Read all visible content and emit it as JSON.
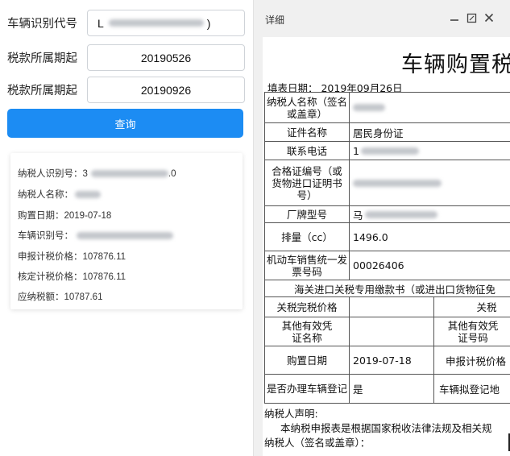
{
  "query_form": {
    "vin_label": "车辆识别代号",
    "vin_value": "L",
    "vin_value_end": ")",
    "period_start_label": "税款所属期起",
    "period_start_value": "20190526",
    "period_end_label": "税款所属期起",
    "period_end_value": "20190926",
    "query_button": "查询"
  },
  "result": {
    "taxpayer_id_label": "纳税人识别号：",
    "taxpayer_id_value": "3",
    "taxpayer_id_tail": ".0",
    "taxpayer_name_label": "纳税人名称：",
    "purchase_date_label": "购置日期：",
    "purchase_date_value": "2019-07-18",
    "vin_label": "车辆识别号：",
    "declared_price_label": "申报计税价格：",
    "declared_price_value": "107876.11",
    "assessed_price_label": "核定计税价格：",
    "assessed_price_value": "107876.11",
    "tax_payable_label": "应纳税额：",
    "tax_payable_value": "10787.61"
  },
  "dialog": {
    "title": "详细",
    "minimize_icon": "minimize-icon",
    "maximize_icon": "maximize-icon",
    "close_icon": "close-icon",
    "doc_title": "车辆购置税",
    "fill_date": "填表日期：  2019年09月26日",
    "rows": {
      "taxpayer_name_label": "纳税人名称（签名或盖章）",
      "id_type_label": "证件名称",
      "id_type_value": "居民身份证",
      "phone_label": "联系电话",
      "phone_value": "1",
      "cert_label": "合格证编号（或货物进口证明书号）",
      "model_label": "厂牌型号",
      "model_value": "马",
      "displacement_label": "排量（cc）",
      "displacement_value": "1496.0",
      "invoice_label": "机动车销售统一发票号码",
      "invoice_value": "00026406",
      "customs_header": "海关进口关税专用缴款书（或进出口货物征免",
      "customs_price_label": "关税完税价格",
      "customs_tax_label": "关税",
      "other_cert_name_label": "其他有效凭证名称",
      "other_cert_no_label": "其他有效凭证号码",
      "purchase_date_label": "购置日期",
      "purchase_date_value": "2019-07-18",
      "declared_price_label": "申报计税价格",
      "registered_label": "是否办理车辆登记",
      "registered_value": "是",
      "reg_place_label": "车辆拟登记地"
    },
    "declaration_title": "纳税人声明:",
    "declaration_text": "本纳税申报表是根据国家税收法律法规及相关规",
    "signature_label": "纳税人（签名或盖章）："
  }
}
